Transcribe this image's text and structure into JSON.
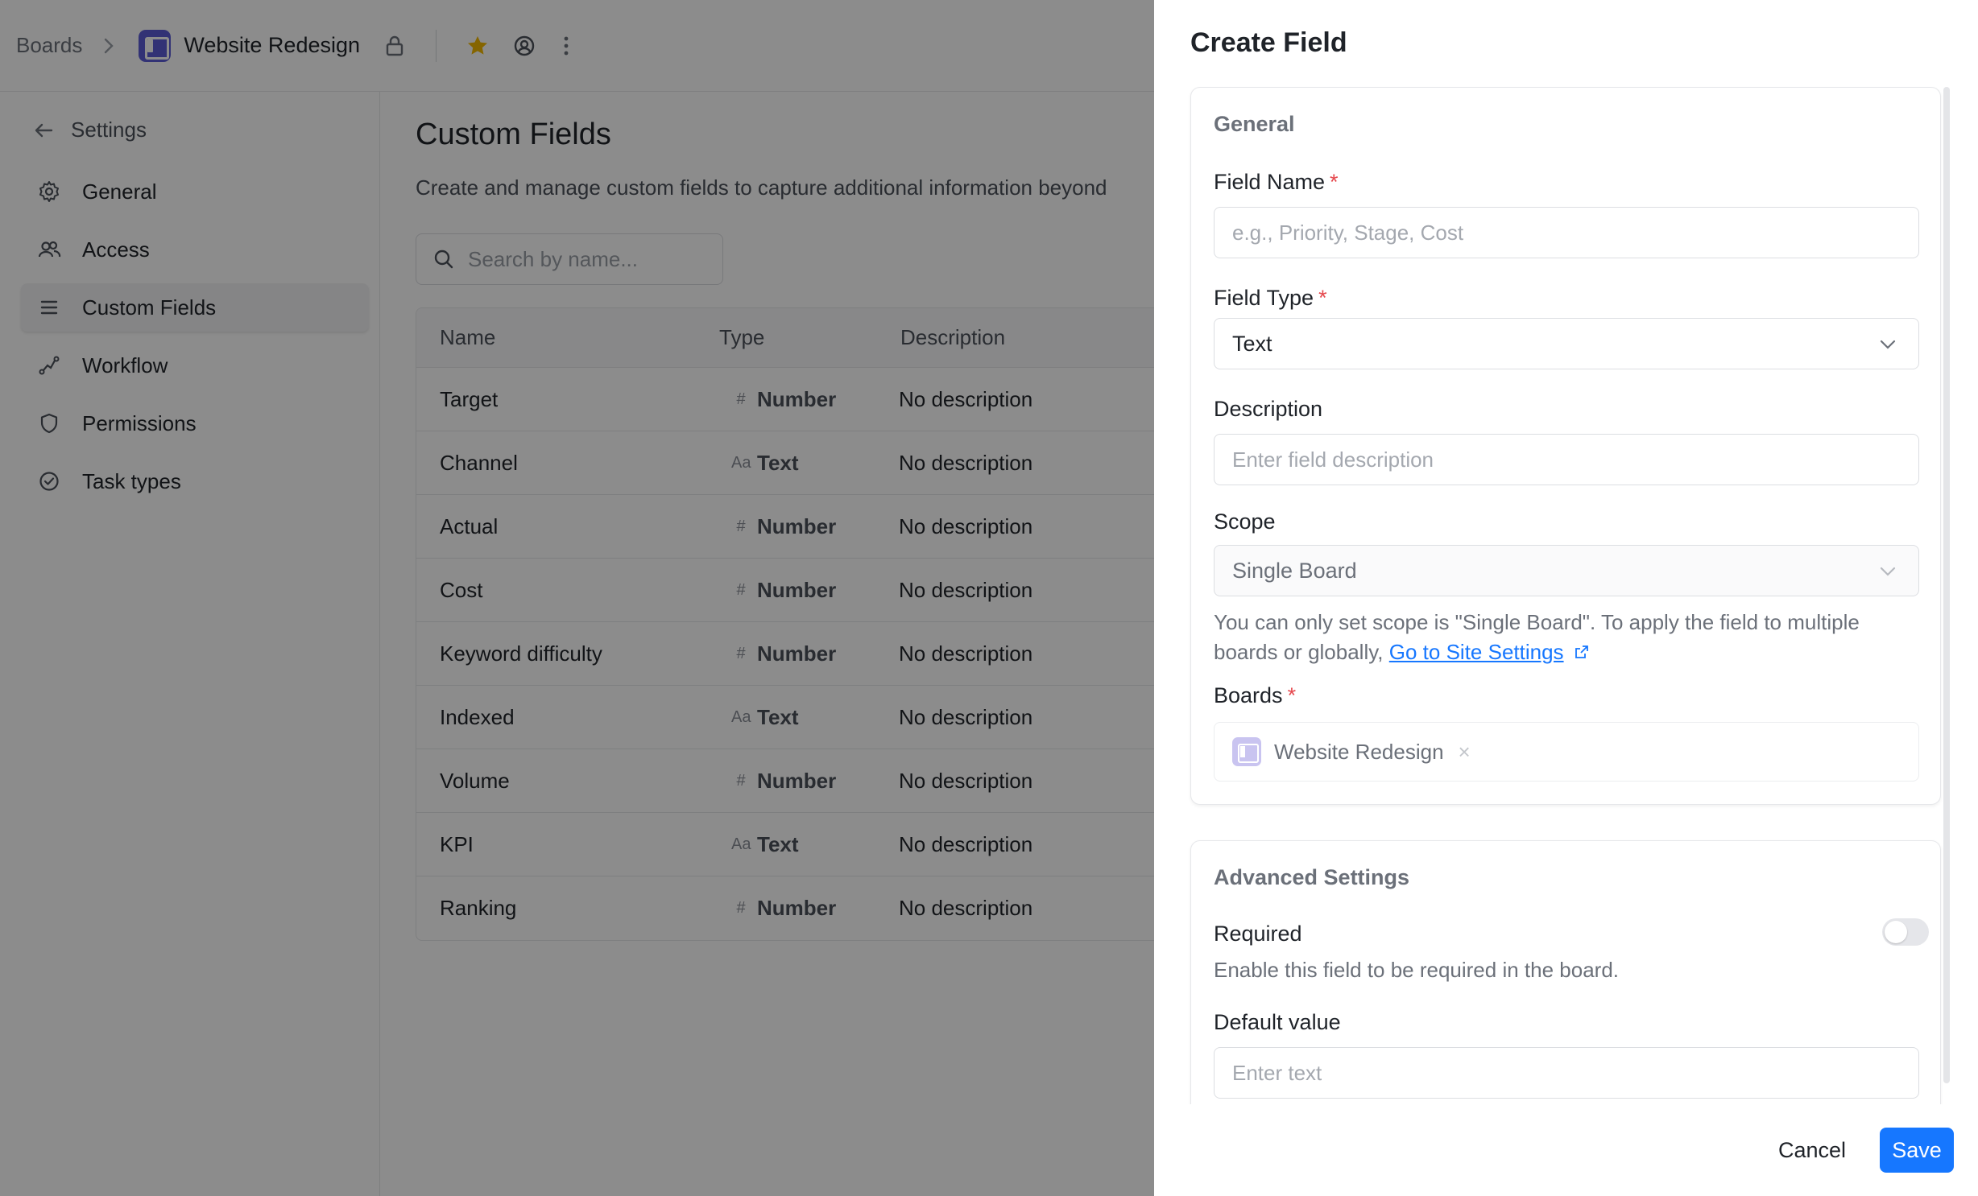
{
  "breadcrumb": {
    "root": "Boards",
    "board_name": "Website Redesign"
  },
  "settings_sidebar": {
    "back_label": "Settings",
    "items": [
      {
        "label": "General",
        "icon": "gear-icon"
      },
      {
        "label": "Access",
        "icon": "users-icon"
      },
      {
        "label": "Custom Fields",
        "icon": "list-icon",
        "active": true
      },
      {
        "label": "Workflow",
        "icon": "workflow-icon"
      },
      {
        "label": "Permissions",
        "icon": "shield-icon"
      },
      {
        "label": "Task types",
        "icon": "check-circle-icon"
      }
    ]
  },
  "main": {
    "title": "Custom Fields",
    "description": "Create and manage custom fields to capture additional information beyond",
    "search_placeholder": "Search by name...",
    "columns": [
      "Name",
      "Type",
      "Description"
    ],
    "rows": [
      {
        "name": "Target",
        "type_glyph": "#",
        "type": "Number",
        "description": "No description"
      },
      {
        "name": "Channel",
        "type_glyph": "Aa",
        "type": "Text",
        "description": "No description"
      },
      {
        "name": "Actual",
        "type_glyph": "#",
        "type": "Number",
        "description": "No description"
      },
      {
        "name": "Cost",
        "type_glyph": "#",
        "type": "Number",
        "description": "No description"
      },
      {
        "name": "Keyword difficulty",
        "type_glyph": "#",
        "type": "Number",
        "description": "No description"
      },
      {
        "name": "Indexed",
        "type_glyph": "Aa",
        "type": "Text",
        "description": "No description"
      },
      {
        "name": "Volume",
        "type_glyph": "#",
        "type": "Number",
        "description": "No description"
      },
      {
        "name": "KPI",
        "type_glyph": "Aa",
        "type": "Text",
        "description": "No description"
      },
      {
        "name": "Ranking",
        "type_glyph": "#",
        "type": "Number",
        "description": "No description"
      }
    ]
  },
  "drawer": {
    "title": "Create Field",
    "general": {
      "section_title": "General",
      "field_name": {
        "label": "Field Name",
        "required_mark": "*",
        "placeholder": "e.g., Priority, Stage, Cost",
        "value": ""
      },
      "field_type": {
        "label": "Field Type",
        "required_mark": "*",
        "value": "Text"
      },
      "description": {
        "label": "Description",
        "placeholder": "Enter field description",
        "value": ""
      },
      "scope": {
        "label": "Scope",
        "value": "Single Board",
        "help_text": "You can only set scope is \"Single Board\". To apply the field to multiple boards or globally,",
        "link_text": "Go to Site Settings"
      },
      "boards": {
        "label": "Boards",
        "required_mark": "*",
        "selected": "Website Redesign",
        "remove_glyph": "×"
      }
    },
    "advanced": {
      "section_title": "Advanced Settings",
      "required": {
        "label": "Required",
        "help": "Enable this field to be required in the board.",
        "enabled": false
      },
      "default_value": {
        "label": "Default value",
        "placeholder": "Enter text",
        "value": ""
      }
    },
    "footer": {
      "cancel_label": "Cancel",
      "save_label": "Save"
    }
  },
  "colors": {
    "accent": "#1677ff",
    "brand": "#5b5bd6",
    "required": "#e5484d",
    "star": "#f2b900"
  }
}
